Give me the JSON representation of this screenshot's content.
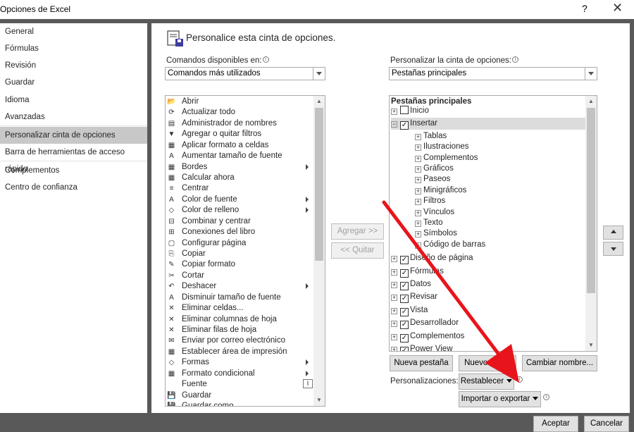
{
  "window": {
    "title": "Opciones de Excel",
    "help": "?",
    "close": "✕"
  },
  "nav": {
    "items": [
      {
        "label": "General"
      },
      {
        "label": "Fórmulas"
      },
      {
        "label": "Revisión"
      },
      {
        "label": "Guardar"
      },
      {
        "label": "Idioma"
      },
      {
        "label": "Avanzadas"
      },
      {
        "label": "Personalizar cinta de opciones",
        "selected": true
      },
      {
        "label": "Barra de herramientas de acceso rápido"
      },
      {
        "label": "Complementos"
      },
      {
        "label": "Centro de confianza"
      }
    ]
  },
  "header": {
    "title": "Personalice esta cinta de opciones."
  },
  "left": {
    "label": "Comandos disponibles en:",
    "combo_value": "Comandos más utilizados",
    "commands": [
      {
        "label": "Abrir",
        "icon": "📂"
      },
      {
        "label": "Actualizar todo",
        "icon": "⟳"
      },
      {
        "label": "Administrador de nombres",
        "icon": "▤"
      },
      {
        "label": "Agregar o quitar filtros",
        "icon": "▼"
      },
      {
        "label": "Aplicar formato a celdas",
        "icon": "▦"
      },
      {
        "label": "Aumentar tamaño de fuente",
        "icon": "A"
      },
      {
        "label": "Bordes",
        "icon": "▦",
        "submenu": true
      },
      {
        "label": "Calcular ahora",
        "icon": "▦"
      },
      {
        "label": "Centrar",
        "icon": "≡"
      },
      {
        "label": "Color de fuente",
        "icon": "A",
        "submenu": true
      },
      {
        "label": "Color de relleno",
        "icon": "◇",
        "submenu": true
      },
      {
        "label": "Combinar y centrar",
        "icon": "⊟"
      },
      {
        "label": "Conexiones del libro",
        "icon": "⊞"
      },
      {
        "label": "Configurar página",
        "icon": "▢"
      },
      {
        "label": "Copiar",
        "icon": "⎘"
      },
      {
        "label": "Copiar formato",
        "icon": "✎"
      },
      {
        "label": "Cortar",
        "icon": "✂"
      },
      {
        "label": "Deshacer",
        "icon": "↶",
        "submenu": true
      },
      {
        "label": "Disminuir tamaño de fuente",
        "icon": "A"
      },
      {
        "label": "Eliminar celdas...",
        "icon": "✕"
      },
      {
        "label": "Eliminar columnas de hoja",
        "icon": "✕"
      },
      {
        "label": "Eliminar filas de hoja",
        "icon": "✕"
      },
      {
        "label": "Enviar por correo electrónico",
        "icon": "✉"
      },
      {
        "label": "Establecer área de impresión",
        "icon": "▦"
      },
      {
        "label": "Formas",
        "icon": "◇",
        "submenu": true
      },
      {
        "label": "Formato condicional",
        "icon": "▦",
        "submenu": true
      },
      {
        "label": "Fuente",
        "icon": "",
        "fontbox": "I"
      },
      {
        "label": "Guardar",
        "icon": "💾"
      },
      {
        "label": "Guardar como",
        "icon": "💾"
      }
    ]
  },
  "middle": {
    "add_label": "Agregar >>",
    "remove_label": "<< Quitar"
  },
  "right": {
    "label": "Personalizar la cinta de opciones:",
    "combo_value": "Pestañas principales",
    "tree_header": "Pestañas principales",
    "tabs": [
      {
        "label": "Inicio",
        "expanded": false,
        "checked": false
      },
      {
        "label": "Insertar",
        "expanded": true,
        "checked": true,
        "selected": true
      },
      {
        "label": "Diseño de página",
        "expanded": false,
        "checked": true
      },
      {
        "label": "Fórmulas",
        "expanded": false,
        "checked": true
      },
      {
        "label": "Datos",
        "expanded": false,
        "checked": true
      },
      {
        "label": "Revisar",
        "expanded": false,
        "checked": true
      },
      {
        "label": "Vista",
        "expanded": false,
        "checked": true
      },
      {
        "label": "Desarrollador",
        "expanded": false,
        "checked": true
      },
      {
        "label": "Complementos",
        "expanded": false,
        "checked": true
      },
      {
        "label": "Power View",
        "expanded": false,
        "checked": true
      }
    ],
    "insert_groups": [
      "Tablas",
      "Ilustraciones",
      "Complementos",
      "Gráficos",
      "Paseos",
      "Minigráficos",
      "Filtros",
      "Vínculos",
      "Texto",
      "Símbolos",
      "Código de barras"
    ],
    "new_tab_label": "Nueva pestaña",
    "new_group_label": "Nuevo grupo",
    "rename_label": "Cambiar nombre...",
    "custom_label": "Personalizaciones:",
    "reset_label": "Restablecer",
    "import_export_label": "Importar o exportar"
  },
  "footer": {
    "ok_label": "Aceptar",
    "cancel_label": "Cancelar"
  },
  "colors": {
    "annotation_arrow": "#e8141c",
    "selected_nav": "#c8c8c8",
    "frame": "#595959"
  }
}
